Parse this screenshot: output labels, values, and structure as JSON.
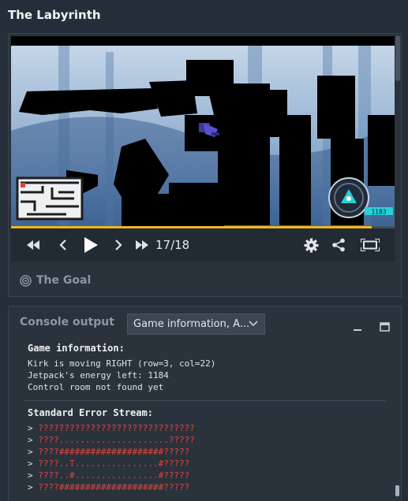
{
  "page": {
    "title": "The Labyrinth"
  },
  "player": {
    "counter": "17/18",
    "progress": 0.94,
    "hud_energy": "1183",
    "goal_label": "The Goal"
  },
  "console": {
    "label": "Console output",
    "select_value": "Game information, A...",
    "game_info_title": "Game information:",
    "game_info_lines": [
      "Kirk is moving RIGHT (row=3, col=22)",
      "Jetpack's energy left: 1184",
      "Control room not found yet"
    ],
    "stderr_title": "Standard Error Stream:",
    "stderr_lines": [
      "??????????????????????????????",
      "????.....................?????",
      "????####################?????",
      "????..T................#?????",
      "????..#................#?????",
      "????####################?????"
    ]
  },
  "icons": {
    "fast_rewind": "fast-rewind-icon",
    "step_back": "step-back-icon",
    "play": "play-icon",
    "step_forward": "step-forward-icon",
    "fast_forward": "fast-forward-icon",
    "settings": "gear-icon",
    "share": "share-icon",
    "fullscreen": "fullscreen-icon",
    "goal": "target-icon",
    "minimize": "minimize-icon",
    "maximize": "maximize-icon"
  },
  "colors": {
    "accent": "#f2b51f",
    "error": "#e0453b",
    "hud": "#2ad0d8"
  }
}
